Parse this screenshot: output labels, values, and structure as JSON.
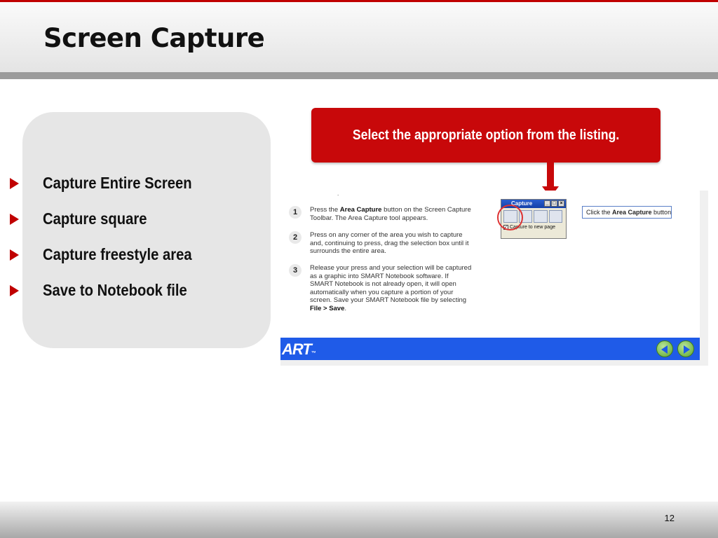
{
  "slide": {
    "title": "Screen Capture",
    "page_number": "12"
  },
  "bullets": [
    "Capture Entire Screen",
    "Capture square",
    "Capture freestyle area",
    "Save to Notebook file"
  ],
  "callout": {
    "text": "Select the appropriate option from the listing."
  },
  "screenshot": {
    "dot": ".",
    "steps": [
      {
        "num": "1",
        "html_parts": {
          "pre": "Press the ",
          "bold": "Area Capture",
          "post": " button on the Screen Capture Toolbar. The Area Capture tool appears."
        }
      },
      {
        "num": "2",
        "text": "Press on any corner of the area you wish to capture and, continuing to press, drag the selection box until it surrounds the entire area."
      },
      {
        "num": "3",
        "html_parts": {
          "pre": "Release your press and your selection will be captured as a graphic into SMART Notebook software. If SMART Notebook is not already open, it will open automatically when you capture a portion of your screen. Save your SMART Notebook file by selecting ",
          "bold": "File > Save",
          "post": "."
        }
      }
    ],
    "capture_window": {
      "title": "Capture",
      "checkbox_label": "Capture to new page",
      "checkbox_checked": true
    },
    "tip": {
      "pre": "Click the ",
      "bold": "Area Capture",
      "post": " button"
    },
    "logo": "ART",
    "logo_tm": "™"
  },
  "colors": {
    "accent_red": "#c00000",
    "callout_red": "#c8080a",
    "smart_bar_blue": "#1f5be8"
  }
}
